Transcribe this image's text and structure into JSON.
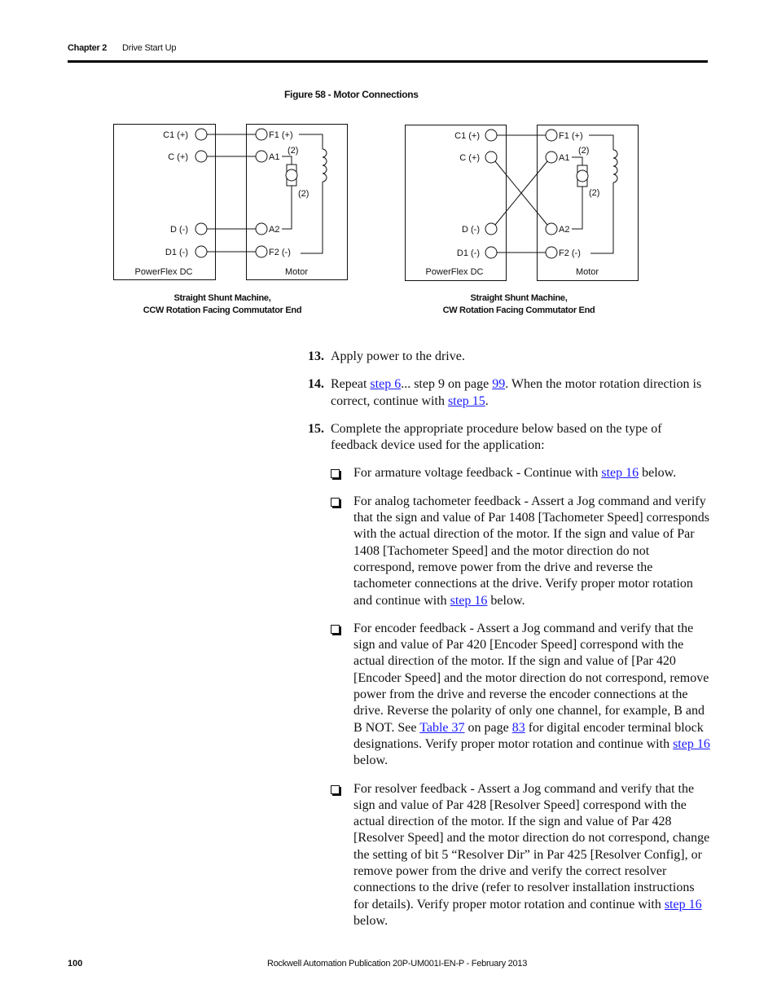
{
  "header": {
    "chapter": "Chapter 2",
    "section": "Drive Start Up"
  },
  "figure": {
    "title": "Figure 58 - Motor Connections",
    "diagrams": [
      {
        "drive_label": "PowerFlex DC",
        "motor_label": "Motor",
        "drive_terminals": [
          "C1 (+)",
          "C (+)",
          "D (-)",
          "D1 (-)"
        ],
        "motor_terminals": [
          "F1 (+)",
          "A1",
          "A2",
          "F2 (-)"
        ],
        "note_top": "(2)",
        "note_bottom": "(2)",
        "wiring": "straight",
        "caption_line1": "Straight Shunt Machine,",
        "caption_line2": "CCW Rotation Facing Commutator End"
      },
      {
        "drive_label": "PowerFlex DC",
        "motor_label": "Motor",
        "drive_terminals": [
          "C1 (+)",
          "C (+)",
          "D (-)",
          "D1 (-)"
        ],
        "motor_terminals": [
          "F1 (+)",
          "A1",
          "A2",
          "F2 (-)"
        ],
        "note_top": "(2)",
        "note_bottom": "(2)",
        "wiring": "crossed armature",
        "caption_line1": "Straight Shunt Machine,",
        "caption_line2": "CW Rotation Facing Commutator End"
      }
    ]
  },
  "steps": [
    {
      "number": "13.",
      "text": "Apply power to the drive."
    },
    {
      "number": "14.",
      "t1": "Repeat ",
      "link1": "step 6",
      "t2": "... step 9 on page ",
      "link2": "99",
      "t3": ". When the motor rotation direction is correct, continue with ",
      "link3": "step 15",
      "t4": "."
    },
    {
      "number": "15.",
      "text": "Complete the appropriate procedure below based on the type of feedback device used for the application:",
      "bullets": [
        {
          "t1": "For armature voltage feedback - Continue with ",
          "link1": "step 16",
          "t2": " below."
        },
        {
          "t1": "For analog tachometer feedback - Assert a Jog command and verify that the sign and value of Par 1408 [Tachometer Speed] corresponds with the actual direction of the motor. If the sign and value of Par 1408 [Tachometer Speed] and the motor direction do not correspond, remove power from the drive and reverse the tachometer connections at the drive. Verify proper motor rotation and continue with ",
          "link1": "step 16",
          "t2": " below."
        },
        {
          "t1": "For encoder feedback - Assert a Jog command and verify that the sign and value of Par 420 [Encoder Speed] correspond with the actual direction of the motor. If the sign and value of [Par 420 [Encoder Speed] and the motor direction do not correspond, remove power from the drive and reverse the encoder connections at the drive. Reverse the polarity of only one channel, for example, B and B NOT. See ",
          "link1": "Table 37",
          "t2": " on page ",
          "link2": "83",
          "t3": " for digital encoder terminal block designations. Verify proper motor rotation and continue with ",
          "link3": "step 16",
          "t4": " below."
        },
        {
          "t1": "For resolver feedback - Assert a Jog command and verify that the sign and value of Par 428 [Resolver Speed] correspond with the actual direction of the motor. If the sign and value of Par 428 [Resolver Speed] and the motor direction do not correspond, change the setting of bit 5 “Resolver Dir” in Par 425 [Resolver Config], or remove power from the drive and verify the correct resolver connections to the drive (refer to resolver installation instructions for details). Verify proper motor rotation and continue with ",
          "link1": "step 16",
          "t2": " below."
        }
      ]
    }
  ],
  "footer": {
    "page_number": "100",
    "publication": "Rockwell Automation Publication 20P-UM001I-EN-P - February 2013"
  },
  "colors": {
    "link": "#1a1aff",
    "text": "#111111"
  }
}
